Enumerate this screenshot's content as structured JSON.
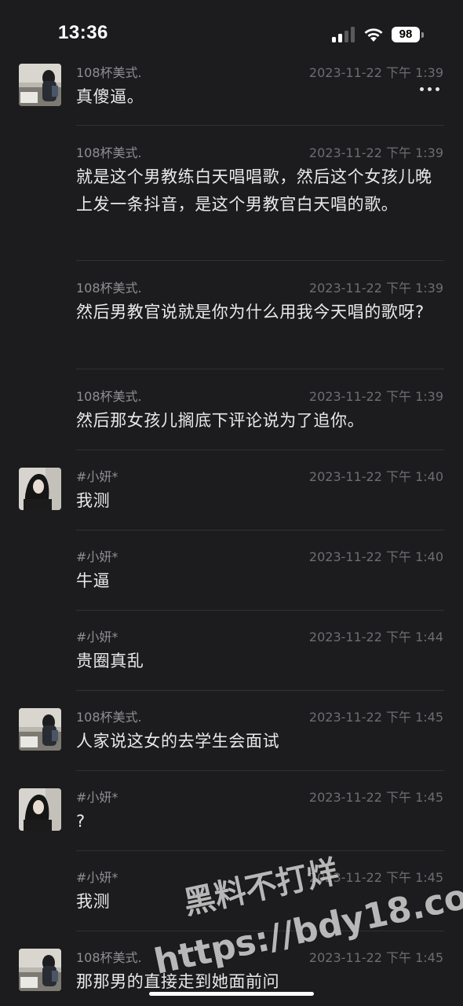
{
  "status_bar": {
    "time": "13:36",
    "battery": "98",
    "icons": [
      "signal-icon",
      "wifi-icon",
      "battery-icon"
    ]
  },
  "header": {
    "more_icon": "more-icon"
  },
  "messages": [
    {
      "sender": "108杯美式.",
      "time": "2023-11-22 下午 1:39",
      "text": "真傻逼。",
      "avatar": "avatar-108"
    },
    {
      "sender": "108杯美式.",
      "time": "2023-11-22 下午 1:39",
      "text": "就是这个男教练白天唱唱歌，然后这个女孩儿晚上发一条抖音，是这个男教官白天唱的歌。"
    },
    {
      "sender": "108杯美式.",
      "time": "2023-11-22 下午 1:39",
      "text": "然后男教官说就是你为什么用我今天唱的歌呀?"
    },
    {
      "sender": "108杯美式.",
      "time": "2023-11-22 下午 1:39",
      "text": "然后那女孩儿搁底下评论说为了追你。"
    },
    {
      "sender": "#小妍*",
      "time": "2023-11-22 下午 1:40",
      "text": "我测",
      "avatar": "avatar-xiaoyan"
    },
    {
      "sender": "#小妍*",
      "time": "2023-11-22 下午 1:40",
      "text": "牛逼"
    },
    {
      "sender": "#小妍*",
      "time": "2023-11-22 下午 1:44",
      "text": "贵圈真乱"
    },
    {
      "sender": "108杯美式.",
      "time": "2023-11-22 下午 1:45",
      "text": "人家说这女的去学生会面试",
      "avatar": "avatar-108"
    },
    {
      "sender": "#小妍*",
      "time": "2023-11-22 下午 1:45",
      "text": "?",
      "avatar": "avatar-xiaoyan"
    },
    {
      "sender": "#小妍*",
      "time": "2023-11-22 下午 1:45",
      "text": "我测"
    },
    {
      "sender": "108杯美式.",
      "time": "2023-11-22 下午 1:45",
      "text": "那那男的直接走到她面前问",
      "avatar": "avatar-108"
    }
  ],
  "watermark": {
    "line1": "黑料不打烊",
    "line2": "https://bdy18.co"
  }
}
